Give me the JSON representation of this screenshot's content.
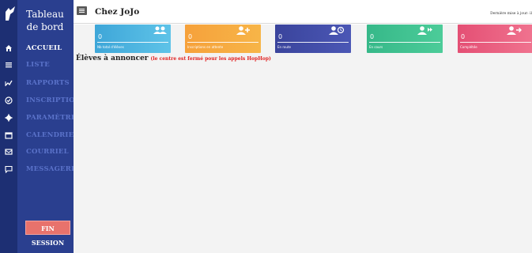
{
  "sidebar": {
    "brand": "Tableau de bord",
    "items": [
      {
        "label": "ACCUEIL",
        "icon": "home-icon",
        "active": true
      },
      {
        "label": "LISTE",
        "icon": "list-icon",
        "active": false
      },
      {
        "label": "RAPPORTS",
        "icon": "chart-icon",
        "active": false
      },
      {
        "label": "INSCRIPTION",
        "icon": "badge-check-icon",
        "active": false
      },
      {
        "label": "PARAMÈTRES",
        "icon": "gear-icon",
        "active": false
      },
      {
        "label": "CALENDRIER",
        "icon": "calendar-icon",
        "active": false
      },
      {
        "label": "COURRIEL",
        "icon": "email-icon",
        "active": false
      },
      {
        "label": "MESSAGERIE",
        "icon": "chat-icon",
        "active": false
      }
    ],
    "logout_label": "FIN SESSION"
  },
  "header": {
    "title": "Chez JoJo",
    "last_update": "Dernière mise à jour: il"
  },
  "cards": [
    {
      "value": "0",
      "label": "Nb total d'élèves",
      "icon": "users-icon",
      "color": "#4ab5dd"
    },
    {
      "value": "0",
      "label": "Inscriptions en attente",
      "icon": "user-add-icon",
      "color": "#f6a13b"
    },
    {
      "value": "0",
      "label": "En route",
      "icon": "user-clock-icon",
      "color": "#3f4aa3"
    },
    {
      "value": "0",
      "label": "En cours",
      "icon": "user-forward-icon",
      "color": "#3dbf8c"
    },
    {
      "value": "0",
      "label": "Complétée",
      "icon": "user-arrow-icon",
      "color": "#e9587a"
    }
  ],
  "section": {
    "title": "Élèves à annoncer",
    "note": "(le centre est fermé pour les appels HopHop)"
  },
  "colors": {
    "sidebar": "#2a3f8f",
    "sidebar_rail": "#1d2f73",
    "logout": "#e8726c",
    "note": "#e02020"
  }
}
